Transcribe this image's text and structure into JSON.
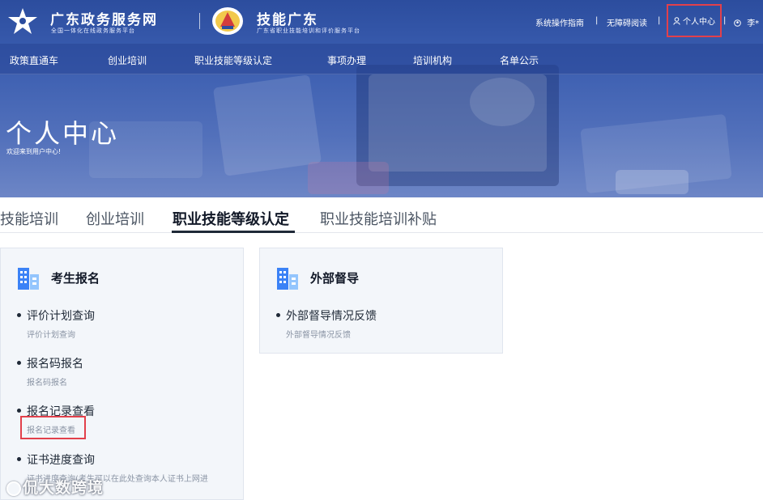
{
  "header": {
    "site_title": "广东政务服务网",
    "site_subtitle": "全国一体化在线政务服务平台",
    "site2_title": "技能广东",
    "site2_subtitle": "广东省职业技能培训和评价服务平台",
    "links": {
      "guide": "系统操作指南",
      "accessible": "无障碍阅读",
      "personal_center": "个人中心",
      "user": "李*",
      "separator": "|"
    }
  },
  "nav": {
    "items": [
      "政策直通车",
      "创业培训",
      "职业技能等级认定",
      "事项办理",
      "培训机构",
      "名单公示"
    ]
  },
  "hero": {
    "title": "个人中心",
    "subtitle": "欢迎来到用户中心!"
  },
  "tabs": {
    "items": [
      "技能培训",
      "创业培训",
      "职业技能等级认定",
      "职业技能培训补贴"
    ],
    "active_index": 2
  },
  "cards": {
    "left": {
      "title": "考生报名",
      "items": [
        {
          "title": "评价计划查询",
          "desc": "评价计划查询"
        },
        {
          "title": "报名码报名",
          "desc": "报名码报名"
        },
        {
          "title": "报名记录查看",
          "desc": "报名记录查看"
        },
        {
          "title": "证书进度查询",
          "desc": "证书进度查询(考生可以在此处查询本人证书上网进"
        }
      ]
    },
    "right": {
      "title": "外部督导",
      "items": [
        {
          "title": "外部督导情况反馈",
          "desc": "外部督导情况反馈"
        }
      ]
    }
  },
  "watermark": "侃大数跨境",
  "colors": {
    "header_blue": "#2c4d9e",
    "highlight_red": "#e2404b",
    "card_bg": "#f3f6fa",
    "icon_blue": "#3b82f6"
  }
}
